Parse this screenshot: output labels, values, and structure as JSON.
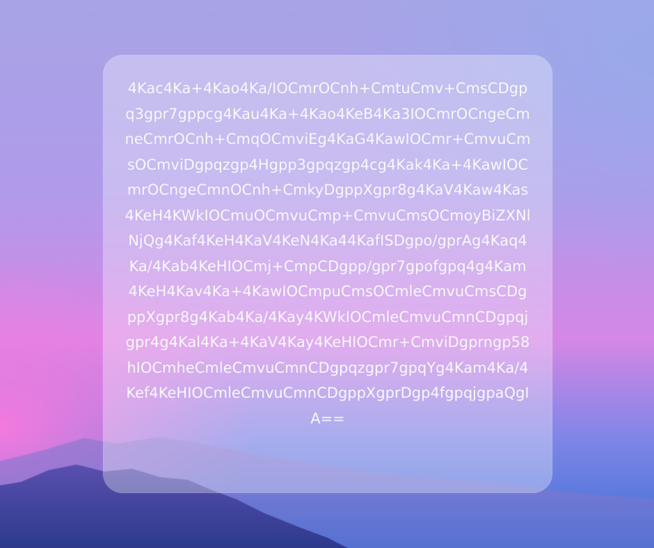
{
  "background": {
    "colors": [
      "#a7a4e6",
      "#d487e6",
      "#3b6fd6",
      "#2f3f8f"
    ]
  },
  "card": {
    "text": "4Kac4Ka+4Kao4Ka/IOCmrOCnh+CmtuCmv+CmsCDgpq3gpr7gppcg4Kau4Ka+4Kao4KeB4Ka3IOCmrOCngeCmneCmrOCnh+CmqOCmviEg4KaG4KawIOCmr+CmvuCmsOCmviDgpqzgp4Hgpp3gpqzgp4cg4Kak4Ka+4KawIOCmrOCngeCmnOCnh+CmkyDgppXgpr8g4KaV4Kaw4Kas4KeH4KWkIOCmuOCmvuCmp+CmvuCmsOCmoyBiZXNlNjQg4Kaf4KeH4KaV4KeN4Ka44KafISDgpo/gprAg4Kaq4Ka/4Kab4KeHIOCmj+CmpCDgpp/gpr7gpofgpq4g4Kam4KeH4Kav4Ka+4KawIOCmpuCmsOCmleCmvuCmsCDgppXgpr8g4Kab4Ka/4Kay4KWkIOCmleCmvuCmnCDgpqjgpr4g4Kal4Ka+4KaV4Kay4KeHIOCmr+CmviDgprngp58hIOCmheCmleCmvuCmnCDgpqzgpr7gpqYg4Kam4Ka/4Kef4KeHIOCmleCmvuCmnCDgppXgprDgp4fgpqjgpaQgIA=="
  }
}
